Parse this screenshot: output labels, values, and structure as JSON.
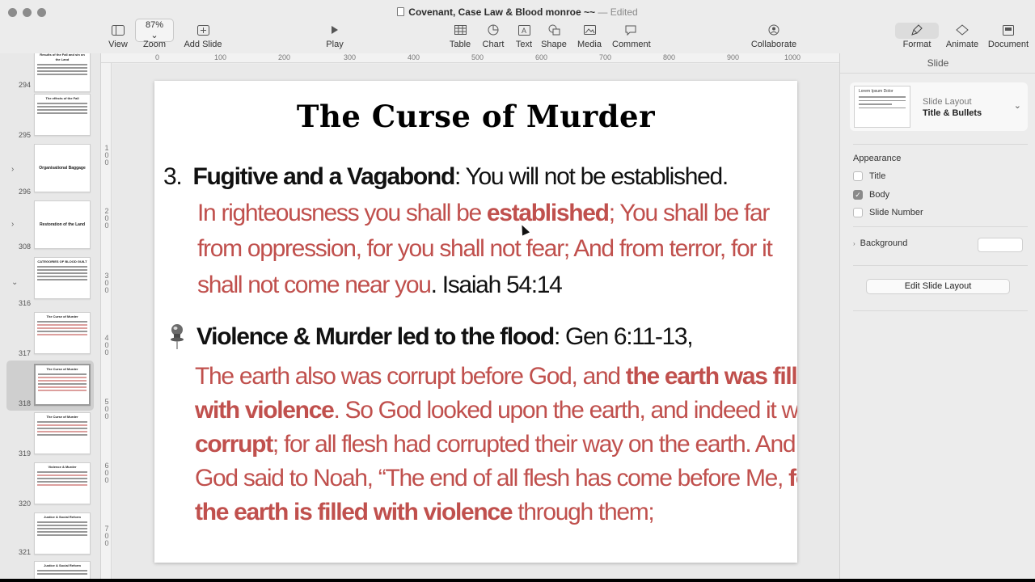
{
  "window": {
    "title": "Covenant, Case Law & Blood monroe ~~",
    "separator": "—",
    "status": "Edited"
  },
  "toolbar": {
    "view": "View",
    "zoom_value": "87%",
    "zoom": "Zoom",
    "add_slide": "Add Slide",
    "play": "Play",
    "table": "Table",
    "chart": "Chart",
    "text": "Text",
    "shape": "Shape",
    "media": "Media",
    "comment": "Comment",
    "collaborate": "Collaborate",
    "format": "Format",
    "animate": "Animate",
    "document": "Document"
  },
  "ruler": {
    "top": [
      "0",
      "100",
      "200",
      "300",
      "400",
      "500",
      "600",
      "700",
      "800",
      "900",
      "1000"
    ],
    "left": [
      "1\n0\n0",
      "2\n0\n0",
      "3\n0\n0",
      "4\n0\n0",
      "5\n0\n0",
      "6\n0\n0",
      "7\n0\n0"
    ]
  },
  "navigator": {
    "slides": [
      {
        "number": "294",
        "title": "Results of the Fall and sin on the Land"
      },
      {
        "number": "295",
        "title": "The effects of the Fall"
      },
      {
        "number": "296",
        "title": "Organisational Baggage"
      },
      {
        "number": "308",
        "title": "Restoration of the Land"
      },
      {
        "number": "316",
        "title": "CATEGORIES OF BLOOD GUILT"
      },
      {
        "number": "317",
        "title": "The Curse of Murder"
      },
      {
        "number": "318",
        "title": "The Curse of Murder"
      },
      {
        "number": "319",
        "title": "The Curse of Murder"
      },
      {
        "number": "320",
        "title": "Violence & Murder"
      },
      {
        "number": "321",
        "title": "Justice & Social Reform"
      },
      {
        "number": "",
        "title": "Justice & Social Reform"
      }
    ]
  },
  "slide": {
    "title": "The Curse of Murder",
    "p1_num": "3.",
    "p1_bold": "Fugitive and a Vagabond",
    "p1_rest": ": You will not be established.",
    "q1_l1a": "In righteousness you shall be ",
    "q1_l1b": "established",
    "q1_l1c": "; You shall be far",
    "q1_l2": "from oppression, for you shall not fear; And from terror, for it",
    "q1_l3a": "shall not come near you",
    "q1_l3b": ". Isaiah 54:14",
    "p2_bold": "Violence & Murder led to the flood",
    "p2_rest": ": Gen 6:11-13,",
    "q2_l1a": "The earth also was corrupt before God, and ",
    "q2_l1b": "the earth was filled",
    "q2_l2a": "with violence",
    "q2_l2b": ". So God looked upon the earth, and indeed it was",
    "q2_l3a": "corrupt",
    "q2_l3b": "; for all flesh had corrupted their way on the earth. And",
    "q2_l4a": "God said to Noah, “The end of all flesh has come before Me, ",
    "q2_l4b": "for",
    "q2_l5a": "the earth is filled with violence",
    "q2_l5b": " through them;"
  },
  "inspector": {
    "heading": "Slide",
    "layout_label": "Slide Layout",
    "layout_value": "Title & Bullets",
    "layout_thumb_title": "Lorem Ipsum Dolor",
    "appearance": "Appearance",
    "opt_title": "Title",
    "opt_body": "Body",
    "opt_slide_number": "Slide Number",
    "background": "Background",
    "edit_layout": "Edit Slide Layout"
  },
  "colors": {
    "scripture_red": "#c0504d",
    "window_bg": "#ececec"
  }
}
